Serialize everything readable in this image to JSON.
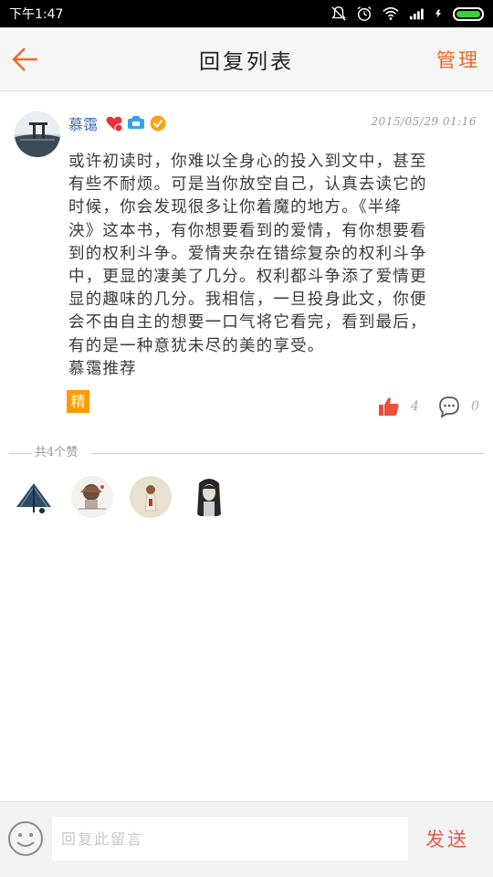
{
  "status_bar": {
    "time": "下午1:47",
    "icons": [
      "mute-icon",
      "alarm-icon",
      "wifi-icon",
      "signal-icon",
      "charging-icon",
      "battery-icon"
    ],
    "battery_color": "#33d633"
  },
  "header": {
    "title": "回复列表",
    "manage_label": "管理",
    "accent_color": "#f26522"
  },
  "post": {
    "author": "慕霭",
    "time": "2015/05/29 01:16",
    "body_lines": [
      "或许初读时，你难以全身心的投入到文中，甚至",
      "有些不耐烦。可是当你放空自己，认真去读它的",
      "时候，你会发现很多让你着魔的地方。《半绛",
      "泱》这本书，有你想要看到的爱情，有你想要看",
      "到的权利斗争。爱情夹杂在错综复杂的权利斗争",
      "中，更显的凄美了几分。权利都斗争添了爱情更",
      "显的趣味的几分。我相信，一旦投身此文，你便",
      "会不由自主的想要一口气将它看完，看到最后，",
      "有的是一种意犹未尽的美的享受。",
      "慕霭推荐"
    ],
    "featured_tag": "精",
    "likes": "4",
    "comments": "0"
  },
  "likes_section": {
    "label": "共4个赞"
  },
  "footer": {
    "input_placeholder": "回复此留言",
    "send_label": "发送"
  }
}
